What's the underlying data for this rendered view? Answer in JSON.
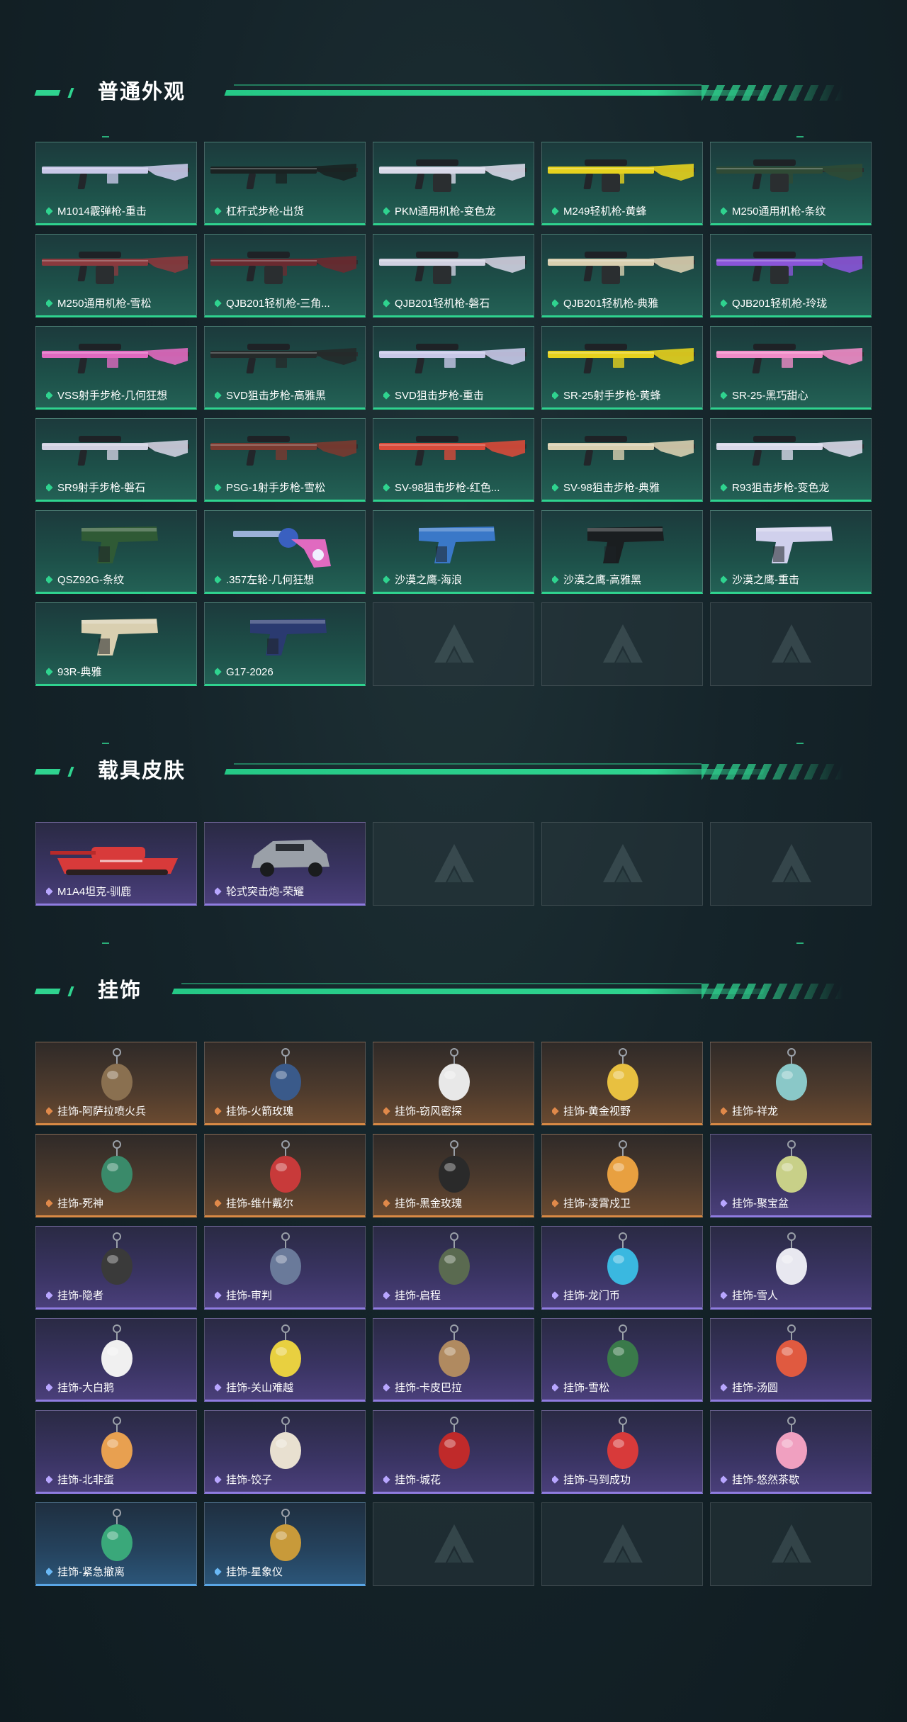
{
  "sections": [
    {
      "title": "普通外观",
      "items": [
        {
          "label": "M1014霰弹枪-重击",
          "tone": "green",
          "kind": "long",
          "accent": "#c8c8e8"
        },
        {
          "label": "杠杆式步枪-出货",
          "tone": "green",
          "kind": "long",
          "accent": "#1a2222"
        },
        {
          "label": "PKM通用机枪-变色龙",
          "tone": "green",
          "kind": "mg",
          "accent": "#d8d8e8"
        },
        {
          "label": "M249轻机枪-黄蜂",
          "tone": "green",
          "kind": "mg",
          "accent": "#e6d21e"
        },
        {
          "label": "M250通用机枪-条纹",
          "tone": "green",
          "kind": "mg",
          "accent": "#2f4a35"
        },
        {
          "label": "M250通用机枪-雪松",
          "tone": "green",
          "kind": "mg",
          "accent": "#8a3a3e"
        },
        {
          "label": "QJB201轻机枪-三角...",
          "tone": "green",
          "kind": "mg",
          "accent": "#6a2a30"
        },
        {
          "label": "QJB201轻机枪-磐石",
          "tone": "green",
          "kind": "mg",
          "accent": "#d0d0e0"
        },
        {
          "label": "QJB201轻机枪-典雅",
          "tone": "green",
          "kind": "mg",
          "accent": "#d9cfb0"
        },
        {
          "label": "QJB201轻机枪-玲珑",
          "tone": "green",
          "kind": "mg",
          "accent": "#8a55d8"
        },
        {
          "label": "VSS射手步枪-几何狂想",
          "tone": "green",
          "kind": "rifle",
          "accent": "#e06ac0"
        },
        {
          "label": "SVD狙击步枪-高雅黑",
          "tone": "green",
          "kind": "rifle",
          "accent": "#252a2a"
        },
        {
          "label": "SVD狙击步枪-重击",
          "tone": "green",
          "kind": "rifle",
          "accent": "#c8c8e8"
        },
        {
          "label": "SR-25射手步枪-黄蜂",
          "tone": "green",
          "kind": "rifle",
          "accent": "#e6d21e"
        },
        {
          "label": "SR-25-黑巧甜心",
          "tone": "green",
          "kind": "rifle",
          "accent": "#f08cc8"
        },
        {
          "label": "SR9射手步枪-磐石",
          "tone": "green",
          "kind": "rifle",
          "accent": "#d0d0e0"
        },
        {
          "label": "PSG-1射手步枪-雪松",
          "tone": "green",
          "kind": "rifle",
          "accent": "#7a3a30"
        },
        {
          "label": "SV-98狙击步枪-红色...",
          "tone": "green",
          "kind": "rifle",
          "accent": "#d84a3a"
        },
        {
          "label": "SV-98狙击步枪-典雅",
          "tone": "green",
          "kind": "rifle",
          "accent": "#d9cfb0"
        },
        {
          "label": "R93狙击步枪-变色龙",
          "tone": "green",
          "kind": "rifle",
          "accent": "#d8d8e8"
        },
        {
          "label": "QSZ92G-条纹",
          "tone": "green",
          "kind": "pistol",
          "accent": "#2f5a35"
        },
        {
          "label": ".357左轮-几何狂想",
          "tone": "green",
          "kind": "revolver",
          "accent": "#e06ac0"
        },
        {
          "label": "沙漠之鹰-海浪",
          "tone": "green",
          "kind": "pistol",
          "accent": "#3a78c8"
        },
        {
          "label": "沙漠之鹰-高雅黑",
          "tone": "green",
          "kind": "pistol",
          "accent": "#1a1e20"
        },
        {
          "label": "沙漠之鹰-重击",
          "tone": "green",
          "kind": "pistol",
          "accent": "#d0d0ec"
        },
        {
          "label": "93R-典雅",
          "tone": "green",
          "kind": "pistol",
          "accent": "#d9cfb0"
        },
        {
          "label": "G17-2026",
          "tone": "green",
          "kind": "pistol",
          "accent": "#2a3a70"
        }
      ]
    },
    {
      "title": "载具皮肤",
      "items": [
        {
          "label": "M1A4坦克-驯鹿",
          "tone": "purple",
          "kind": "tank",
          "accent": "#d83a3a"
        },
        {
          "label": "轮式突击炮-荣耀",
          "tone": "purple",
          "kind": "car",
          "accent": "#9aa0a8"
        }
      ]
    },
    {
      "title": "挂饰",
      "items": [
        {
          "label": "挂饰-阿萨拉喷火兵",
          "tone": "orange",
          "kind": "charm",
          "accent": "#8a7050"
        },
        {
          "label": "挂饰-火箭玫瑰",
          "tone": "orange",
          "kind": "charm",
          "accent": "#3a5a8a"
        },
        {
          "label": "挂饰-窃风密探",
          "tone": "orange",
          "kind": "charm",
          "accent": "#e8e8e8"
        },
        {
          "label": "挂饰-黄金视野",
          "tone": "orange",
          "kind": "charm",
          "accent": "#e8c040"
        },
        {
          "label": "挂饰-祥龙",
          "tone": "orange",
          "kind": "charm",
          "accent": "#8ac8c8"
        },
        {
          "label": "挂饰-死神",
          "tone": "orange",
          "kind": "charm",
          "accent": "#3a8a6a"
        },
        {
          "label": "挂饰-维什戴尔",
          "tone": "orange",
          "kind": "charm",
          "accent": "#c83a3a"
        },
        {
          "label": "挂饰-黑金玫瑰",
          "tone": "orange",
          "kind": "charm",
          "accent": "#2a2a2a"
        },
        {
          "label": "挂饰-凌霄戍卫",
          "tone": "orange",
          "kind": "charm",
          "accent": "#e8a040"
        },
        {
          "label": "挂饰-聚宝盆",
          "tone": "purple",
          "kind": "charm",
          "accent": "#c8d088"
        },
        {
          "label": "挂饰-隐者",
          "tone": "purple",
          "kind": "charm",
          "accent": "#3a3a3a"
        },
        {
          "label": "挂饰-审判",
          "tone": "purple",
          "kind": "charm",
          "accent": "#6a7a9a"
        },
        {
          "label": "挂饰-启程",
          "tone": "purple",
          "kind": "charm",
          "accent": "#5a6a50"
        },
        {
          "label": "挂饰-龙门币",
          "tone": "purple",
          "kind": "charm",
          "accent": "#3ab8e0"
        },
        {
          "label": "挂饰-雪人",
          "tone": "purple",
          "kind": "charm",
          "accent": "#e8e8f0"
        },
        {
          "label": "挂饰-大白鹅",
          "tone": "purple",
          "kind": "charm",
          "accent": "#f0f0f0"
        },
        {
          "label": "挂饰-关山难越",
          "tone": "purple",
          "kind": "charm",
          "accent": "#e8d040"
        },
        {
          "label": "挂饰-卡皮巴拉",
          "tone": "purple",
          "kind": "charm",
          "accent": "#b08a60"
        },
        {
          "label": "挂饰-雪松",
          "tone": "purple",
          "kind": "charm",
          "accent": "#3a7a4a"
        },
        {
          "label": "挂饰-汤圆",
          "tone": "purple",
          "kind": "charm",
          "accent": "#e05a40"
        },
        {
          "label": "挂饰-北非蛋",
          "tone": "purple",
          "kind": "charm",
          "accent": "#e8a050"
        },
        {
          "label": "挂饰-饺子",
          "tone": "purple",
          "kind": "charm",
          "accent": "#e8e0d0"
        },
        {
          "label": "挂饰-城花",
          "tone": "purple",
          "kind": "charm",
          "accent": "#c02a2a"
        },
        {
          "label": "挂饰-马到成功",
          "tone": "purple",
          "kind": "charm",
          "accent": "#d83a3a"
        },
        {
          "label": "挂饰-悠然茶歇",
          "tone": "purple",
          "kind": "charm",
          "accent": "#f0a0c0"
        },
        {
          "label": "挂饰-紧急撤离",
          "tone": "blue",
          "kind": "charm",
          "accent": "#3aa87a"
        },
        {
          "label": "挂饰-星象仪",
          "tone": "blue",
          "kind": "charm",
          "accent": "#c89a3a"
        }
      ]
    }
  ]
}
